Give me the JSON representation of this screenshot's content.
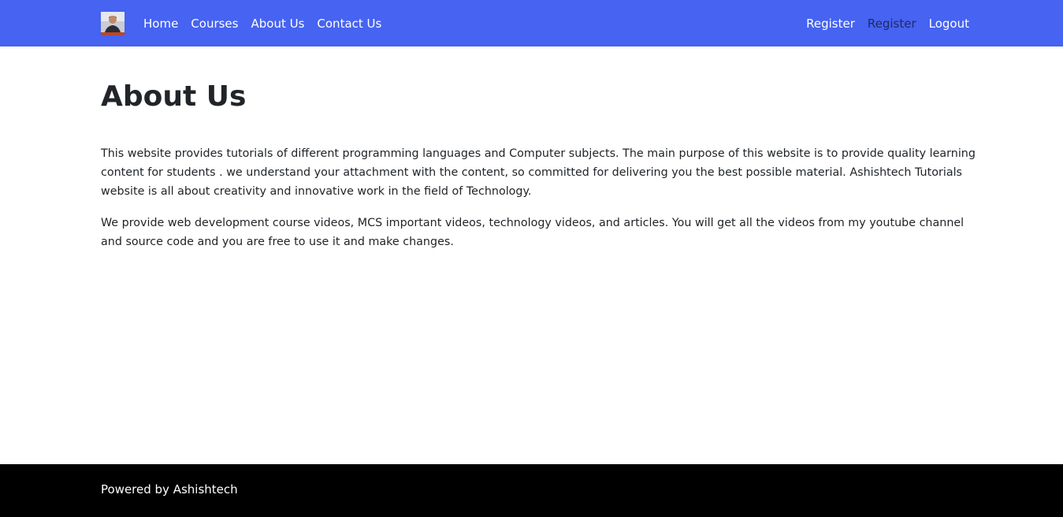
{
  "navbar": {
    "logo_icon": "profile-avatar-icon",
    "background": "#4663f1",
    "links_left": [
      "Home",
      "Courses",
      "About Us",
      "Contact Us"
    ],
    "links_right": [
      "Register",
      "Register",
      "Logout"
    ]
  },
  "main": {
    "title": "About Us",
    "paragraphs": [
      "This website provides tutorials of different programming languages and Computer subjects. The main purpose of this website is to provide quality learning content for students . we understand your attachment with the content, so committed for delivering you the best possible material. Ashishtech Tutorials website is all about creativity and innovative work in the field of Technology.",
      "We provide web development course videos, MCS important videos, technology videos, and articles. You will get all the videos from my youtube channel and source code and you are free to use it and make changes."
    ]
  },
  "footer": {
    "text": "Powered by Ashishtech",
    "background": "#000000"
  }
}
